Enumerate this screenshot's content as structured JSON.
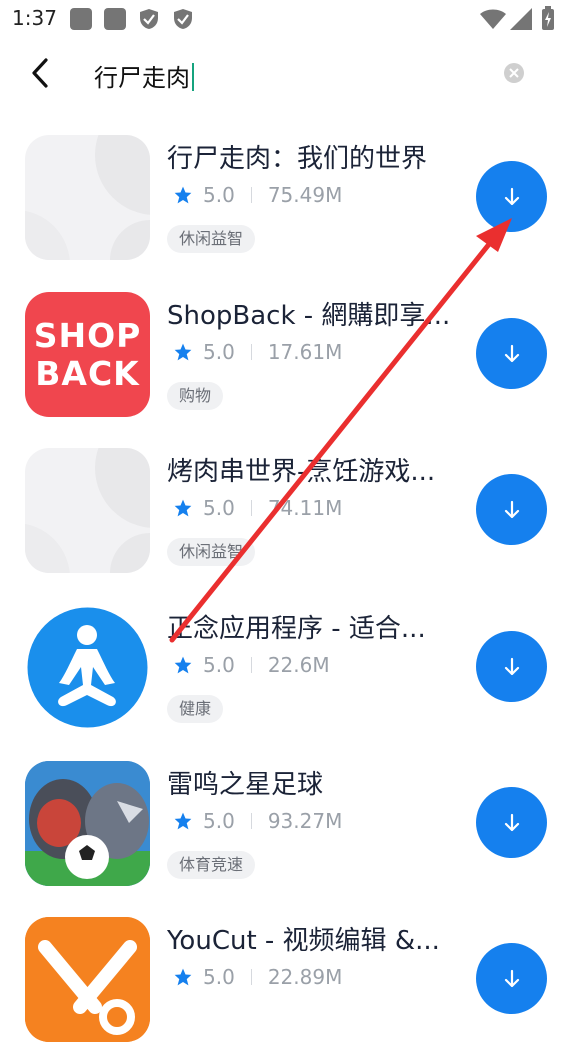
{
  "status_bar": {
    "time": "1:37"
  },
  "search": {
    "query": "行尸走肉"
  },
  "colors": {
    "accent": "#1580ee",
    "annotation": "#ea2f2f"
  },
  "apps": [
    {
      "title": "行尸走肉：我们的世界",
      "rating": "5.0",
      "size": "75.49M",
      "tag": "休闲益智",
      "icon": "placeholder-icon"
    },
    {
      "title": "ShopBack - 網購即享...",
      "rating": "5.0",
      "size": "17.61M",
      "tag": "购物",
      "icon": "shopback-logo-icon",
      "icon_text": [
        "SHOP",
        "BACK"
      ]
    },
    {
      "title": "烤肉串世界-烹饪游戏...",
      "rating": "5.0",
      "size": "74.11M",
      "tag": "休闲益智",
      "icon": "placeholder-icon"
    },
    {
      "title": "正念应用程序 - 适合...",
      "rating": "5.0",
      "size": "22.6M",
      "tag": "健康",
      "icon": "meditation-icon"
    },
    {
      "title": "雷鸣之星足球",
      "rating": "5.0",
      "size": "93.27M",
      "tag": "体育竞速",
      "icon": "soccer-game-icon"
    },
    {
      "title": "YouCut - 视频编辑 &...",
      "rating": "5.0",
      "size": "22.89M",
      "tag": "",
      "icon": "youcut-scissors-icon"
    }
  ]
}
